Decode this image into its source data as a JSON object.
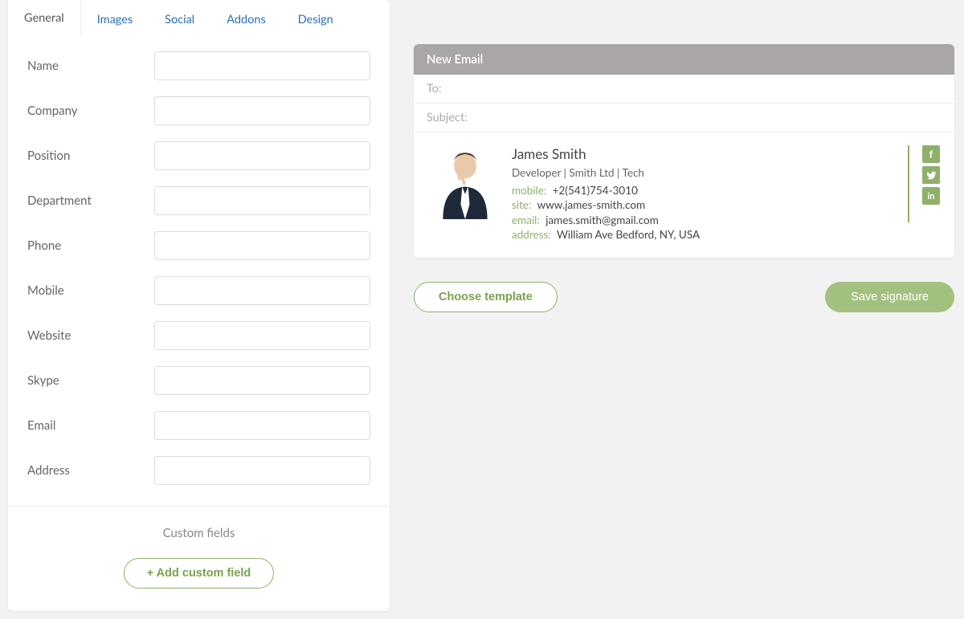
{
  "tabs": [
    {
      "label": "General",
      "active": true
    },
    {
      "label": "Images",
      "active": false
    },
    {
      "label": "Social",
      "active": false
    },
    {
      "label": "Addons",
      "active": false
    },
    {
      "label": "Design",
      "active": false
    }
  ],
  "form_fields": [
    {
      "label": "Name",
      "value": ""
    },
    {
      "label": "Company",
      "value": ""
    },
    {
      "label": "Position",
      "value": ""
    },
    {
      "label": "Department",
      "value": ""
    },
    {
      "label": "Phone",
      "value": ""
    },
    {
      "label": "Mobile",
      "value": ""
    },
    {
      "label": "Website",
      "value": ""
    },
    {
      "label": "Skype",
      "value": ""
    },
    {
      "label": "Email",
      "value": ""
    },
    {
      "label": "Address",
      "value": ""
    }
  ],
  "custom_section_title": "Custom fields",
  "add_custom_field_label": "+ Add custom field",
  "email_preview": {
    "header": "New Email",
    "to_label": "To:",
    "subject_label": "Subject:"
  },
  "signature": {
    "name": "James Smith",
    "position_line": "Developer | Smith Ltd | Tech",
    "mobile_key": "mobile:",
    "mobile_val": "+2(541)754-3010",
    "site_key": "site:",
    "site_val": "www.james-smith.com",
    "email_key": "email:",
    "email_val": "james.smith@gmail.com",
    "address_key": "address:",
    "address_val": "William Ave Bedford, NY, USA"
  },
  "social_icons": [
    "facebook",
    "twitter",
    "linkedin"
  ],
  "choose_template_label": "Choose template",
  "save_signature_label": "Save signature",
  "colors": {
    "accent": "#8fb06a",
    "link": "#2a6fb5"
  }
}
